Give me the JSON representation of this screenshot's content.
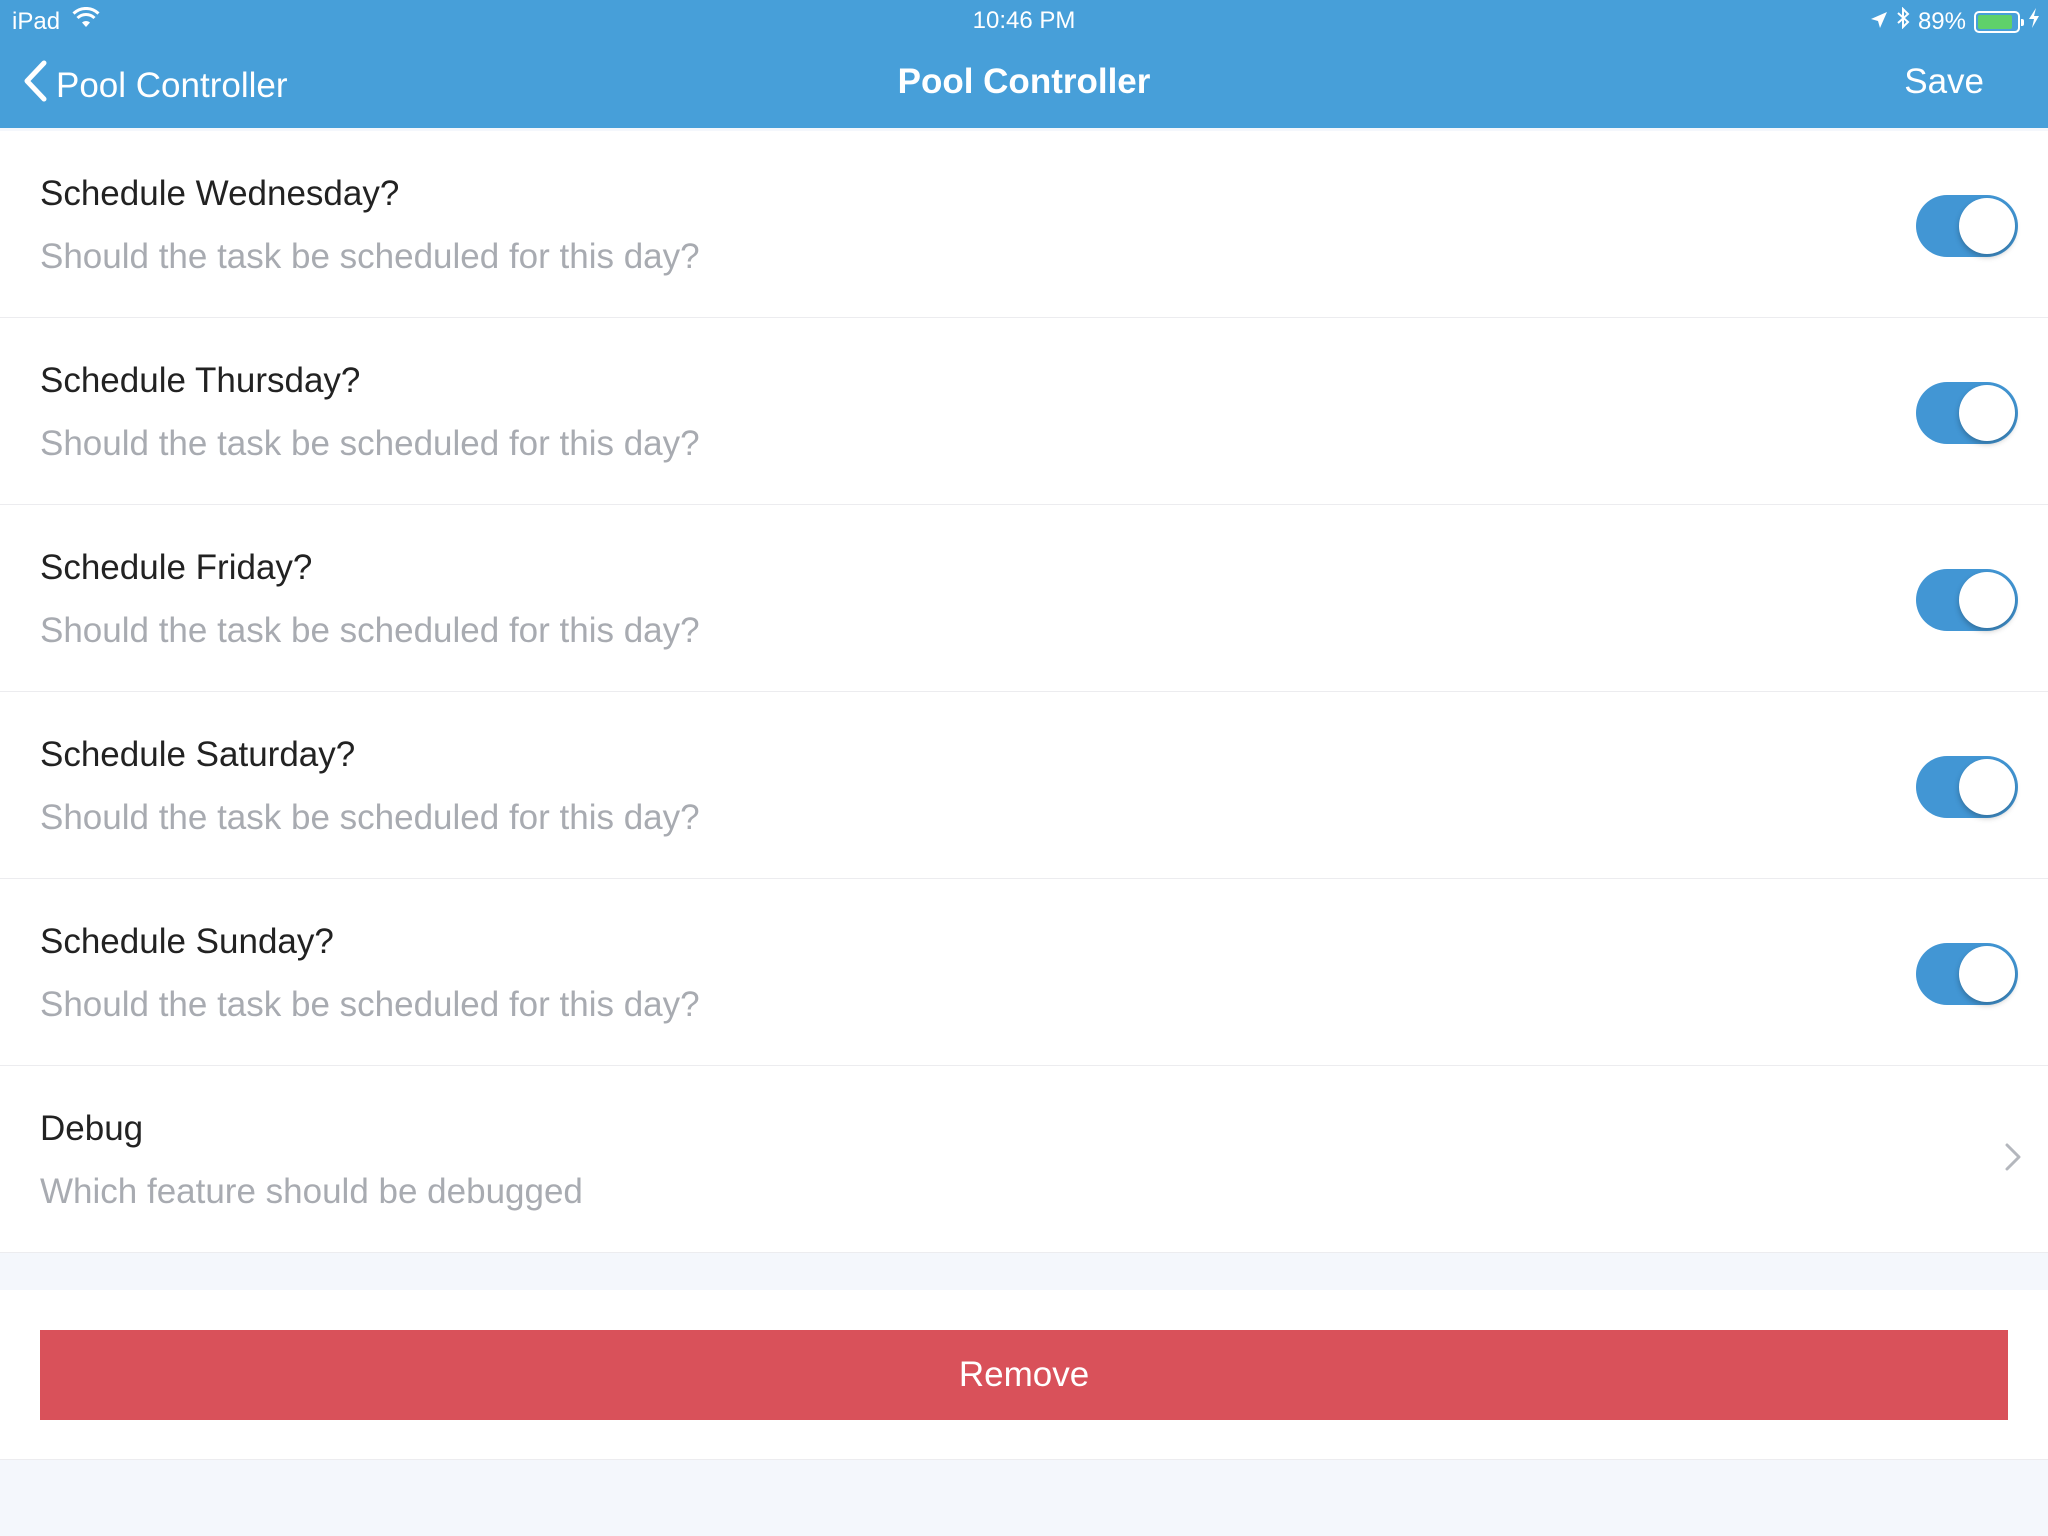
{
  "status_bar": {
    "device": "iPad",
    "time": "10:46 PM",
    "battery_percent": "89%",
    "battery_level": 0.89,
    "battery_color": "#5fd16a",
    "icons": [
      "wifi-icon",
      "location-icon",
      "bluetooth-icon",
      "battery-icon",
      "charging-icon"
    ]
  },
  "nav": {
    "back_label": "Pool Controller",
    "title": "Pool Controller",
    "save_label": "Save",
    "bar_color": "#479fd9"
  },
  "rows": [
    {
      "title": "Schedule Wednesday?",
      "subtitle": "Should the task be scheduled for this day?",
      "toggle_on": true
    },
    {
      "title": "Schedule Thursday?",
      "subtitle": "Should the task be scheduled for this day?",
      "toggle_on": true
    },
    {
      "title": "Schedule Friday?",
      "subtitle": "Should the task be scheduled for this day?",
      "toggle_on": true
    },
    {
      "title": "Schedule Saturday?",
      "subtitle": "Should the task be scheduled for this day?",
      "toggle_on": true
    },
    {
      "title": "Schedule Sunday?",
      "subtitle": "Should the task be scheduled for this day?",
      "toggle_on": true
    },
    {
      "title": "Debug",
      "subtitle": "Which feature should be debugged",
      "icon": "chevron-right-icon"
    }
  ],
  "toggle_color": "#4296d4",
  "remove": {
    "label": "Remove",
    "color": "#d9515a"
  }
}
